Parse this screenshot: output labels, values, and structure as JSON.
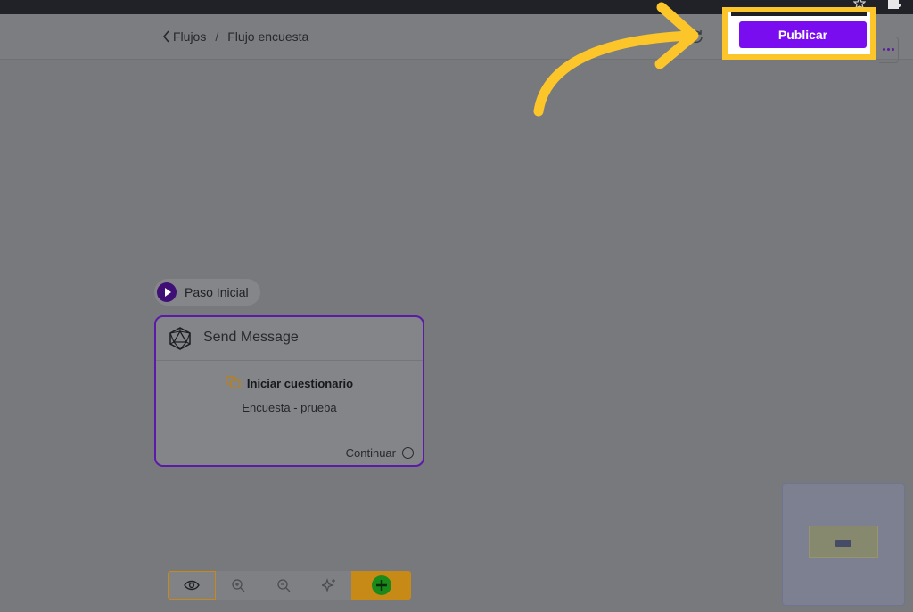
{
  "browser_bar": {
    "icons": [
      "star-icon",
      "puzzle-icon"
    ]
  },
  "header": {
    "breadcrumb": {
      "back_label": "Flujos",
      "separator": "/",
      "current": "Flujo encuesta"
    },
    "publish_label": "Publicar",
    "icons": [
      "chevron-left-icon",
      "sync-icon",
      "more-icon"
    ]
  },
  "annotation": {
    "arrow_color": "#fcc62b",
    "highlight_color": "#fcc62b"
  },
  "flow": {
    "start_node": {
      "label": "Paso Inicial"
    },
    "node": {
      "title": "Send Message",
      "step_title": "Iniciar cuestionario",
      "step_subtitle": "Encuesta - prueba",
      "output_label": "Continuar",
      "icon": "icosahedron-icon",
      "accent": "#5b1aa8"
    }
  },
  "toolbar": {
    "tools": [
      "eye-icon",
      "zoom-in-icon",
      "zoom-out-icon",
      "sparkle-icon",
      "add-icon"
    ]
  },
  "colors": {
    "brand": "#7a0cf0",
    "add": "#1a8a1a",
    "toolbar_accent": "#c88a16"
  }
}
